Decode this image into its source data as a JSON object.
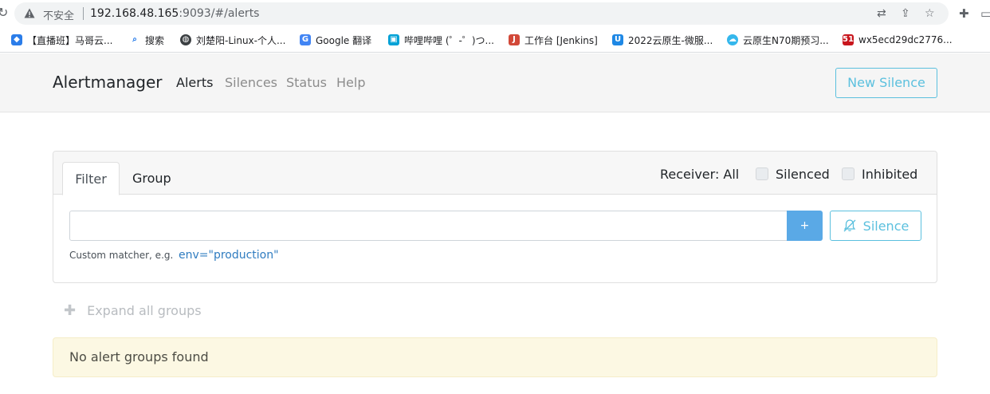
{
  "browser": {
    "insecure_label": "不安全",
    "url_main": "192.168.48.165",
    "url_rest": ":9093/#/alerts",
    "bookmarks": [
      {
        "label": "【直播班】马哥云...",
        "icon": "bookmark-icon",
        "color": "#2b7de9"
      },
      {
        "label": "搜索",
        "icon": "search-icon",
        "color": "#1a73e8"
      },
      {
        "label": "刘楚阳-Linux-个人...",
        "icon": "globe-icon",
        "color": "#3c4043"
      },
      {
        "label": "Google 翻译",
        "icon": "translate-icon",
        "color": "#4285f4"
      },
      {
        "label": "哔哩哔哩 (゜-゜)つ...",
        "icon": "bilibili-icon",
        "color": "#00a1d6"
      },
      {
        "label": "工作台 [Jenkins]",
        "icon": "jenkins-icon",
        "color": "#d24939"
      },
      {
        "label": "2022云原生-微服...",
        "icon": "yuque-icon",
        "color": "#1e88e5"
      },
      {
        "label": "云原生N70期预习...",
        "icon": "cloud-icon",
        "color": "#35b7ec"
      },
      {
        "label": "wx5ecd29dc2776...",
        "icon": "51cto-icon",
        "color": "#c8161d"
      }
    ]
  },
  "navbar": {
    "brand": "Alertmanager",
    "links": [
      "Alerts",
      "Silences",
      "Status",
      "Help"
    ],
    "active_link": "Alerts",
    "new_silence": "New Silence"
  },
  "filter": {
    "tabs": [
      "Filter",
      "Group"
    ],
    "active_tab": "Filter",
    "receiver_label": "Receiver: All",
    "silenced_label": "Silenced",
    "inhibited_label": "Inhibited",
    "input_value": "",
    "add_button": "+",
    "silence_button": "Silence",
    "hint_text": "Custom matcher, e.g.",
    "hint_example": "env=\"production\""
  },
  "groups": {
    "expand_label": "Expand all groups",
    "empty_message": "No alert groups found"
  },
  "colors": {
    "accent_info": "#5bc0de",
    "primary_button": "#5aa9e6",
    "warning_bg": "#fcf8e3"
  }
}
